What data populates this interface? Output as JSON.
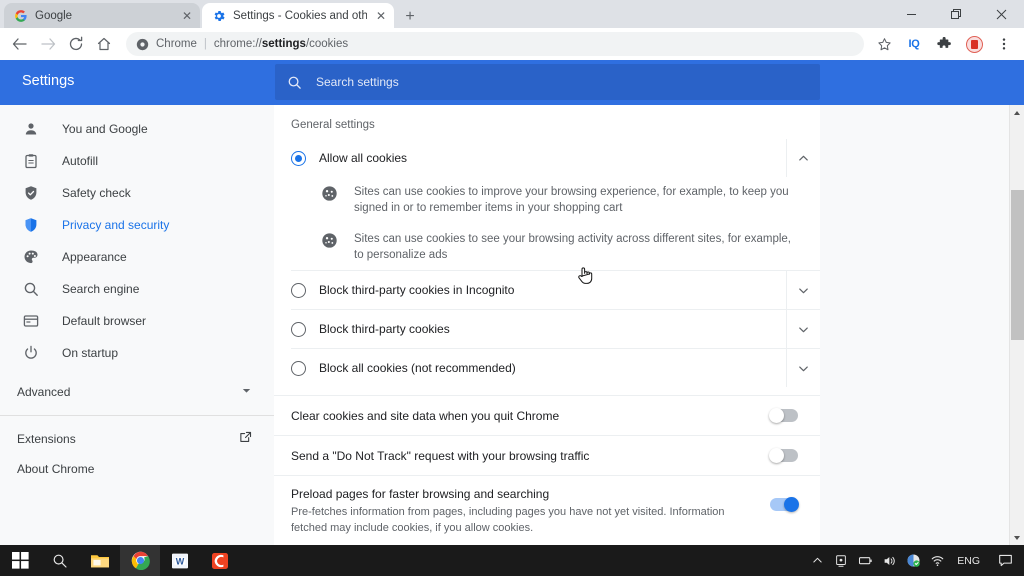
{
  "window": {
    "minimize_label": "Minimize",
    "restore_label": "Restore",
    "close_label": "Close"
  },
  "tabs": [
    {
      "title": "Google",
      "favicon": "google-icon",
      "active": false
    },
    {
      "title": "Settings - Cookies and other site",
      "favicon": "settings-gear-icon",
      "active": true
    }
  ],
  "newtab_label": "+",
  "toolbar": {
    "back": "←",
    "forward": "→",
    "reload": "⟳",
    "home": "⌂",
    "omnibox": {
      "site_label": "Chrome",
      "separator": "|",
      "url_prefix": "chrome://",
      "url_bold": "settings",
      "url_suffix": "/cookies"
    },
    "bookmark_icon": "star-icon",
    "ext_iq_label": "IQ",
    "ext_puzzle_icon": "puzzle-piece-icon",
    "profile_icon": "profile-avatar",
    "menu_icon": "three-dot-menu-icon"
  },
  "settings_header": {
    "title": "Settings",
    "search_placeholder": "Search settings",
    "search_icon": "search-icon",
    "accent": "#2f6fe0",
    "search_bg": "#2a62c8"
  },
  "sidebar": {
    "items": [
      {
        "label": "You and Google",
        "icon": "person-icon",
        "active": false
      },
      {
        "label": "Autofill",
        "icon": "clipboard-icon",
        "active": false
      },
      {
        "label": "Safety check",
        "icon": "shield-check-icon",
        "active": false
      },
      {
        "label": "Privacy and security",
        "icon": "shield-blue-icon",
        "active": true
      },
      {
        "label": "Appearance",
        "icon": "palette-icon",
        "active": false
      },
      {
        "label": "Search engine",
        "icon": "search-icon",
        "active": false
      },
      {
        "label": "Default browser",
        "icon": "browser-window-icon",
        "active": false
      },
      {
        "label": "On startup",
        "icon": "power-icon",
        "active": false
      }
    ],
    "advanced": {
      "label": "Advanced",
      "icon": "chevron-down-icon"
    },
    "footer": [
      {
        "label": "Extensions",
        "icon": "external-link-icon"
      },
      {
        "label": "About Chrome",
        "icon": ""
      }
    ],
    "active_color": "#1a73e8"
  },
  "main": {
    "section_title": "General settings",
    "options": [
      {
        "label": "Allow all cookies",
        "selected": true,
        "expanded": true,
        "chevron": "chevron-up-icon",
        "details": [
          "Sites can use cookies to improve your browsing experience, for example, to keep you signed in or to remember items in your shopping cart",
          "Sites can use cookies to see your browsing activity across different sites, for example, to personalize ads"
        ]
      },
      {
        "label": "Block third-party cookies in Incognito",
        "selected": false,
        "expanded": false,
        "chevron": "chevron-down-icon",
        "details": []
      },
      {
        "label": "Block third-party cookies",
        "selected": false,
        "expanded": false,
        "chevron": "chevron-down-icon",
        "details": []
      },
      {
        "label": "Block all cookies (not recommended)",
        "selected": false,
        "expanded": false,
        "chevron": "chevron-down-icon",
        "details": []
      }
    ],
    "toggles": [
      {
        "title": "Clear cookies and site data when you quit Chrome",
        "sub": "",
        "on": false
      },
      {
        "title": "Send a \"Do Not Track\" request with your browsing traffic",
        "sub": "",
        "on": false
      },
      {
        "title": "Preload pages for faster browsing and searching",
        "sub": "Pre-fetches information from pages, including pages you have not yet visited. Information fetched may include cookies, if you allow cookies.",
        "on": true
      }
    ]
  },
  "scrollbar": {
    "up_arrow": "scroll-up-arrow",
    "down_arrow": "scroll-down-arrow"
  },
  "taskbar": {
    "items": [
      {
        "name": "start-button",
        "selected": false
      },
      {
        "name": "search-taskbar",
        "selected": false
      },
      {
        "name": "file-explorer",
        "selected": false
      },
      {
        "name": "chrome-taskbar",
        "selected": true
      },
      {
        "name": "word-taskbar",
        "selected": false
      },
      {
        "name": "app-c-taskbar",
        "selected": false
      }
    ],
    "tray": {
      "chevron": "tray-expand-chevron",
      "icons": [
        "monitor-icon",
        "battery-icon",
        "volume-icon",
        "security-icon",
        "wifi-icon"
      ],
      "language": "ENG",
      "notification": "notification-icon"
    }
  },
  "cursor": {
    "type": "pointer-hand"
  }
}
